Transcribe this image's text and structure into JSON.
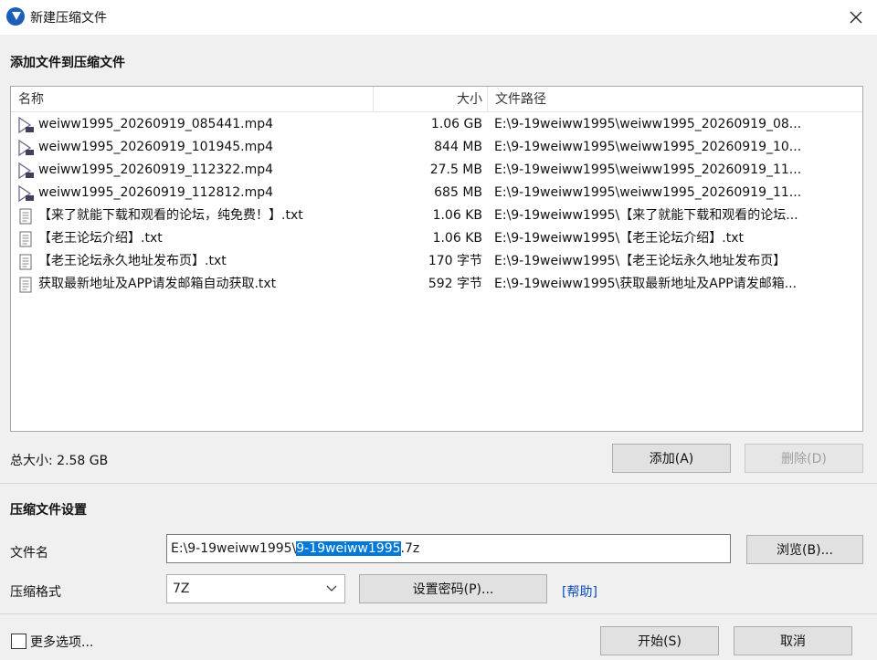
{
  "window": {
    "title": "新建压缩文件"
  },
  "add_section": {
    "title": "添加文件到压缩文件"
  },
  "file_list": {
    "columns": {
      "name": "名称",
      "size": "大小",
      "path": "文件路径"
    },
    "rows": [
      {
        "icon": "video-file-icon",
        "name": "weiww1995_20260919_085441.mp4",
        "size": "1.06 GB",
        "path": "E:\\9-19weiww1995\\weiww1995_20260919_08..."
      },
      {
        "icon": "video-file-icon",
        "name": "weiww1995_20260919_101945.mp4",
        "size": "844 MB",
        "path": "E:\\9-19weiww1995\\weiww1995_20260919_10..."
      },
      {
        "icon": "video-file-icon",
        "name": "weiww1995_20260919_112322.mp4",
        "size": "27.5 MB",
        "path": "E:\\9-19weiww1995\\weiww1995_20260919_11..."
      },
      {
        "icon": "video-file-icon",
        "name": "weiww1995_20260919_112812.mp4",
        "size": "685 MB",
        "path": "E:\\9-19weiww1995\\weiww1995_20260919_11..."
      },
      {
        "icon": "text-file-icon",
        "name": "【来了就能下载和观看的论坛，纯免费！】.txt",
        "size": "1.06 KB",
        "path": "E:\\9-19weiww1995\\【来了就能下载和观看的论坛..."
      },
      {
        "icon": "text-file-icon",
        "name": "【老王论坛介绍】.txt",
        "size": "1.06 KB",
        "path": "E:\\9-19weiww1995\\【老王论坛介绍】.txt"
      },
      {
        "icon": "text-file-icon",
        "name": "【老王论坛永久地址发布页】.txt",
        "size": "170 字节",
        "path": "E:\\9-19weiww1995\\【老王论坛永久地址发布页】"
      },
      {
        "icon": "text-file-icon",
        "name": "获取最新地址及APP请发邮箱自动获取.txt",
        "size": "592 字节",
        "path": "E:\\9-19weiww1995\\获取最新地址及APP请发邮箱..."
      }
    ]
  },
  "summary": {
    "total_size": "总大小: 2.58 GB"
  },
  "buttons": {
    "add": "添加(A)",
    "delete": "删除(D)",
    "browse": "浏览(B)...",
    "set_password": "设置密码(P)...",
    "start": "开始(S)",
    "cancel": "取消"
  },
  "archive_settings": {
    "title": "压缩文件设置",
    "filename_label": "文件名",
    "filename_prefix": "E:\\9-19weiww1995\\",
    "filename_selected": "9-19weiww1995",
    "filename_suffix": ".7z",
    "format_label": "压缩格式",
    "format_value": "7Z",
    "help_link": "[帮助]"
  },
  "more_options": {
    "label": "更多选项..."
  },
  "colors": {
    "selection": "#0078d7",
    "link": "#0a4bbf",
    "app_icon": "#1d5fb6"
  }
}
